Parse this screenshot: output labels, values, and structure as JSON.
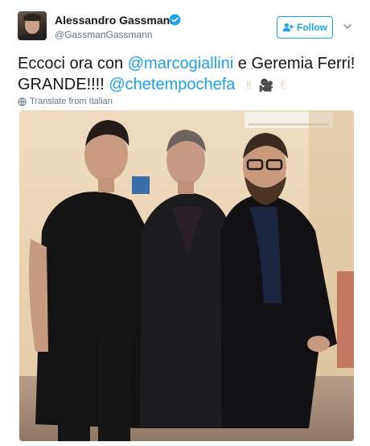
{
  "header": {
    "display_name": "Alessandro Gassmann",
    "handle": "@GassmanGassmann",
    "follow_label": "Follow"
  },
  "tweet": {
    "text_1": "Eccoci ora con ",
    "mention_1": "@marcogiallini",
    "text_2": " e Geremia Ferri! GRANDE!!!! ",
    "mention_2": "@chetempochefa",
    "emoji_1": "✌",
    "emoji_2": "🎥",
    "emoji_3": "✌"
  },
  "translate_label": "Translate from Italian",
  "icons": {
    "verified": "verified-badge-icon",
    "follow": "add-user-icon",
    "caret": "chevron-down-icon",
    "translate": "globe-icon"
  },
  "colors": {
    "accent": "#1da1f2",
    "text": "#14171a",
    "secondary": "#657786"
  }
}
